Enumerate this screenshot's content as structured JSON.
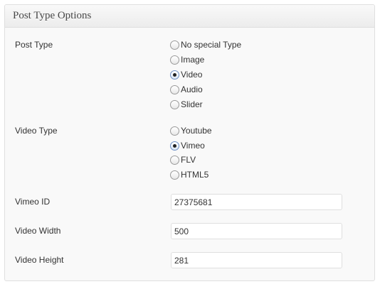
{
  "panel": {
    "title": "Post Type Options"
  },
  "post_type": {
    "label": "Post Type",
    "options": [
      {
        "label": "No special Type",
        "checked": false
      },
      {
        "label": "Image",
        "checked": false
      },
      {
        "label": "Video",
        "checked": true
      },
      {
        "label": "Audio",
        "checked": false
      },
      {
        "label": "Slider",
        "checked": false
      }
    ]
  },
  "video_type": {
    "label": "Video Type",
    "options": [
      {
        "label": "Youtube",
        "checked": false
      },
      {
        "label": "Vimeo",
        "checked": true
      },
      {
        "label": "FLV",
        "checked": false
      },
      {
        "label": "HTML5",
        "checked": false
      }
    ]
  },
  "fields": {
    "vimeo_id": {
      "label": "Vimeo ID",
      "value": "27375681"
    },
    "video_width": {
      "label": "Video Width",
      "value": "500"
    },
    "video_height": {
      "label": "Video Height",
      "value": "281"
    }
  }
}
